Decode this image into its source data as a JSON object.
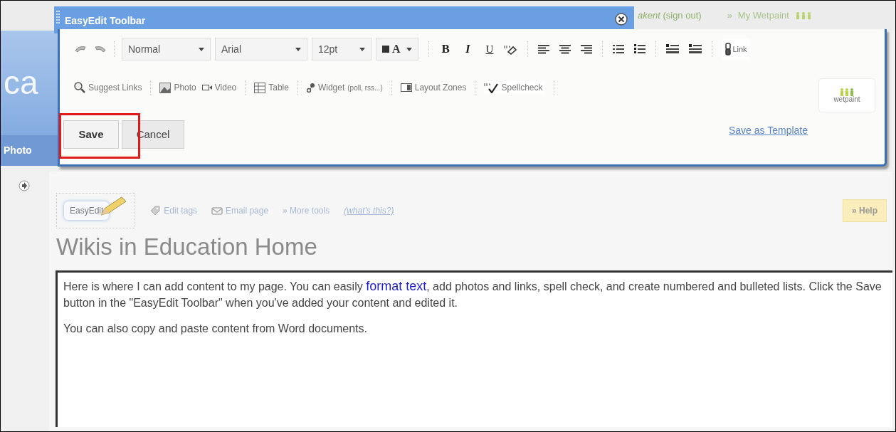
{
  "header": {
    "user": "akent",
    "sign_out": "(sign out)",
    "arrow": "»",
    "my_wetpaint": "My Wetpaint"
  },
  "site": {
    "title_fragment": "ca",
    "nav_item": "Photo"
  },
  "toolbar": {
    "title": "EasyEdit Toolbar",
    "style_select": "Normal",
    "font_select": "Arial",
    "size_select": "12pt",
    "color_letter": "A",
    "bold": "B",
    "italic": "I",
    "underline": "U",
    "link": "Link",
    "insert_items": [
      {
        "kind": "suggest",
        "label": "Suggest Links"
      },
      {
        "kind": "photo",
        "label": "Photo"
      },
      {
        "kind": "video",
        "label": "Video"
      },
      {
        "kind": "table",
        "label": "Table"
      },
      {
        "kind": "widget",
        "label": "Widget",
        "note": "(poll, rss...)"
      },
      {
        "kind": "layout",
        "label": "Layout Zones"
      },
      {
        "kind": "spell",
        "label": "Spellcheck"
      }
    ],
    "logo": "wetpaint",
    "save": "Save",
    "cancel": "Cancel",
    "template_link": "Save as Template"
  },
  "page": {
    "easyedit": "EasyEdit",
    "tools": [
      {
        "kind": "tags",
        "label": "Edit tags"
      },
      {
        "kind": "email",
        "label": "Email page"
      },
      {
        "kind": "more",
        "label": "» More tools"
      },
      {
        "kind": "whats",
        "label": "(what's this?)"
      }
    ],
    "help": "» Help",
    "title": "Wikis in Education Home",
    "paragraphs": [
      "Here is where I can add content to my page. You can easily **format text**, add photos and links, spell check, and create numbered and bulleted lists. Click the Save button in the \"EasyEdit Toolbar\" when you've added your content and edited it.",
      "You can also copy and paste content from Word documents."
    ]
  }
}
